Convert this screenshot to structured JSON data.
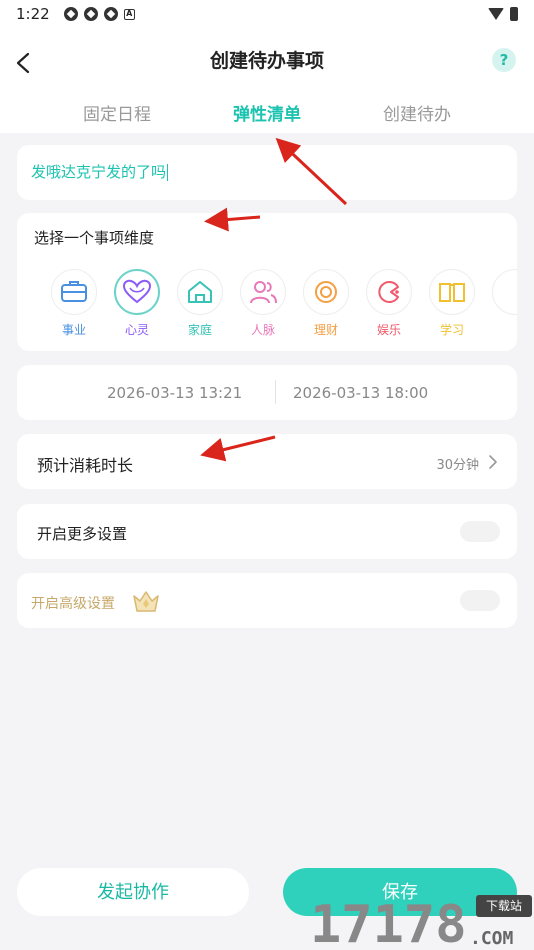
{
  "status_bar": {
    "time": "1:22",
    "indicator": "A"
  },
  "header": {
    "title": "创建待办事项",
    "help": "?"
  },
  "tabs": [
    {
      "label": "固定日程",
      "active": false
    },
    {
      "label": "弹性清单",
      "active": true
    },
    {
      "label": "创建待办",
      "active": false
    }
  ],
  "task": {
    "title_value": "发哦达克宁发的了吗"
  },
  "dimension": {
    "label": "选择一个事项维度",
    "selected": "心灵",
    "items": [
      {
        "name": "事业",
        "icon": "briefcase-icon",
        "color": "#4a90e2"
      },
      {
        "name": "心灵",
        "icon": "heart-icon",
        "color": "#8b5cf6"
      },
      {
        "name": "家庭",
        "icon": "home-icon",
        "color": "#36c2b4"
      },
      {
        "name": "人脉",
        "icon": "people-icon",
        "color": "#e879b9"
      },
      {
        "name": "理财",
        "icon": "coin-icon",
        "color": "#f59e42"
      },
      {
        "name": "娱乐",
        "icon": "game-icon",
        "color": "#ef5b6b"
      },
      {
        "name": "学习",
        "icon": "book-icon",
        "color": "#f0c030"
      }
    ]
  },
  "time_range": {
    "start": "2026-03-13 13:21",
    "end": "2026-03-13 18:00"
  },
  "duration": {
    "label": "预计消耗时长",
    "value": "30分钟"
  },
  "more_settings": {
    "label": "开启更多设置",
    "enabled": false
  },
  "advanced_settings": {
    "label": "开启高级设置",
    "enabled": false
  },
  "actions": {
    "collab_label": "发起协作",
    "save_label": "保存"
  },
  "watermark": {
    "text": "17178",
    "badge": "下载站",
    "suffix": ".COM"
  },
  "colors": {
    "accent": "#1bc3b0",
    "save_button": "#2fd1bc",
    "gold": "#c7a86a",
    "arrow": "#d9251c"
  }
}
